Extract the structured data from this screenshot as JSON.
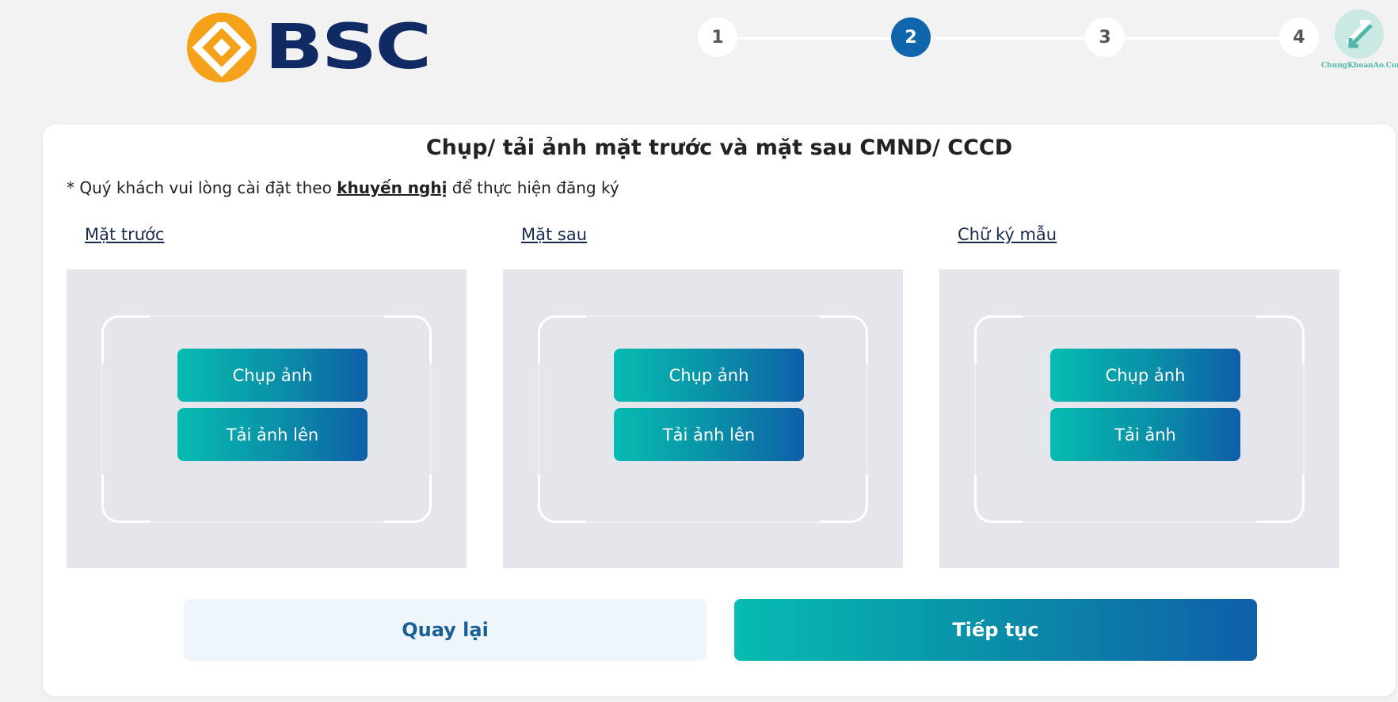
{
  "brand": {
    "name": "BSC",
    "logo_color": "#f5a11a",
    "text_color": "#102a63"
  },
  "stepper": {
    "steps": [
      "1",
      "2",
      "3",
      "4"
    ],
    "active_step": "2",
    "active_color": "#0f66ad"
  },
  "watermark": {
    "text": "ChungKhoanAo.Com"
  },
  "card": {
    "title": "Chụp/ tải ảnh mặt trước và mặt sau CMND/ CCCD",
    "note_prefix": "* Quý khách vui lòng cài đặt theo ",
    "note_link": "khuyến nghị",
    "note_suffix": " để thực hiện đăng ký"
  },
  "columns": [
    {
      "label": "Mặt trước",
      "capture_label": "Chụp ảnh",
      "upload_label": "Tải ảnh lên"
    },
    {
      "label": "Mặt sau",
      "capture_label": "Chụp ảnh",
      "upload_label": "Tải ảnh lên"
    },
    {
      "label": "Chữ ký mẫu",
      "capture_label": "Chụp ảnh",
      "upload_label": "Tải ảnh"
    }
  ],
  "actions": {
    "back_label": "Quay lại",
    "next_label": "Tiếp tục"
  },
  "colors": {
    "gradient_start": "#06bcb1",
    "gradient_end": "#0f5fa8",
    "background": "#f2f2f2"
  }
}
